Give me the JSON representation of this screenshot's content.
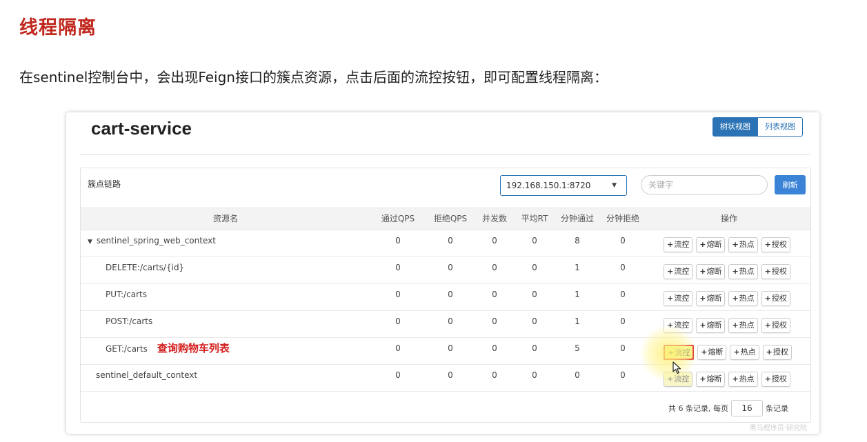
{
  "slide": {
    "title": "线程隔离",
    "description": "在sentinel控制台中，会出现Feign接口的簇点资源，点击后面的流控按钮，即可配置线程隔离："
  },
  "header": {
    "service_name": "cart-service",
    "view_tree": "树状视图",
    "view_list": "列表视图"
  },
  "card": {
    "title": "簇点链路",
    "ip_selected": "192.168.150.1:8720",
    "search_placeholder": "关键字",
    "refresh_label": "刷新"
  },
  "table": {
    "headers": [
      "资源名",
      "通过QPS",
      "拒绝QPS",
      "并发数",
      "平均RT",
      "分钟通过",
      "分钟拒绝",
      "操作"
    ],
    "op_labels": {
      "flow": "流控",
      "degrade": "熔断",
      "hot": "热点",
      "auth": "授权"
    },
    "rows": [
      {
        "name": "sentinel_spring_web_context",
        "pass": "0",
        "block": "0",
        "conc": "0",
        "rt": "0",
        "mpass": "8",
        "mblock": "0"
      },
      {
        "name": "DELETE:/carts/{id}",
        "pass": "0",
        "block": "0",
        "conc": "0",
        "rt": "0",
        "mpass": "1",
        "mblock": "0"
      },
      {
        "name": "PUT:/carts",
        "pass": "0",
        "block": "0",
        "conc": "0",
        "rt": "0",
        "mpass": "1",
        "mblock": "0"
      },
      {
        "name": "POST:/carts",
        "pass": "0",
        "block": "0",
        "conc": "0",
        "rt": "0",
        "mpass": "1",
        "mblock": "0"
      },
      {
        "name": "GET:/carts",
        "annotation": "查询购物车列表",
        "pass": "0",
        "block": "0",
        "conc": "0",
        "rt": "0",
        "mpass": "5",
        "mblock": "0"
      },
      {
        "name": "sentinel_default_context",
        "pass": "0",
        "block": "0",
        "conc": "0",
        "rt": "0",
        "mpass": "0",
        "mblock": "0"
      }
    ]
  },
  "pager": {
    "prefix": "共 6 条记录, 每页",
    "page_size": "16",
    "suffix": "条记录"
  },
  "watermark": "黑马程序员·研究院",
  "colors": {
    "title_red": "#c0281e",
    "primary_blue": "#2b73b5",
    "highlight": "#d9262c"
  }
}
